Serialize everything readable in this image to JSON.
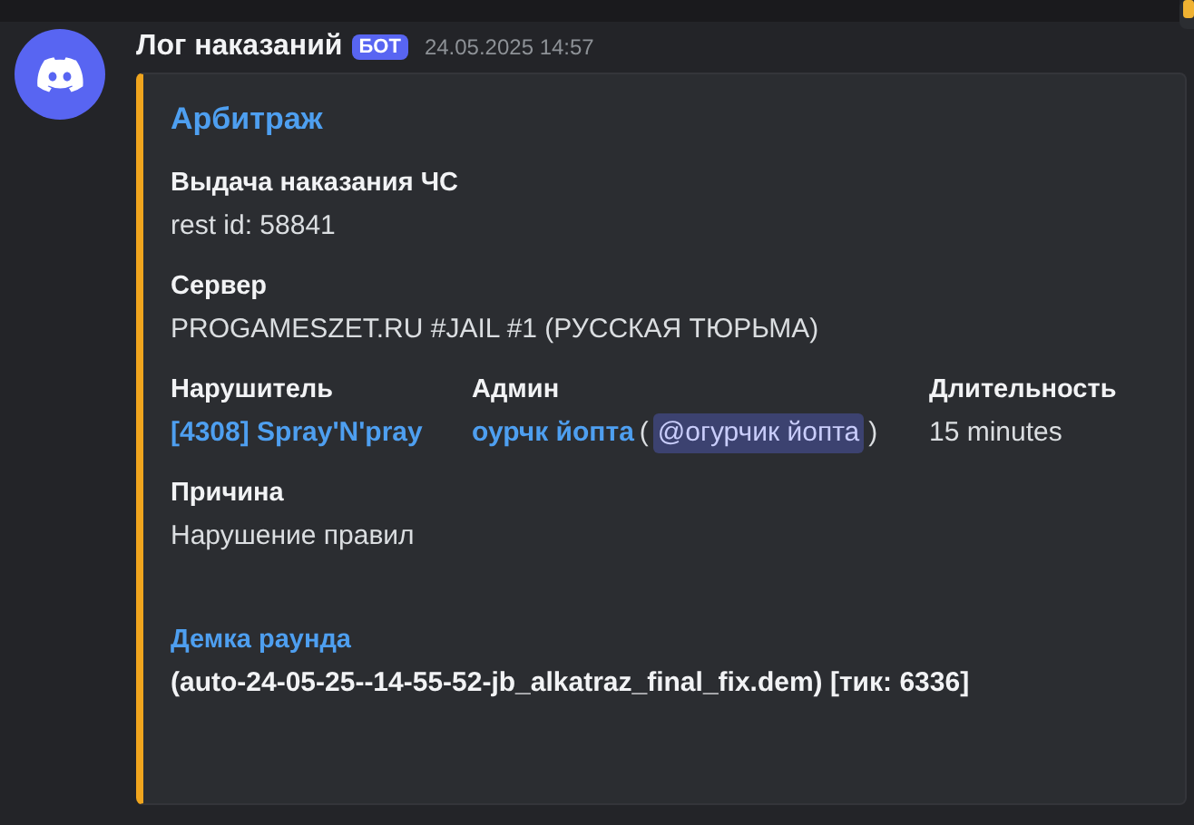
{
  "message": {
    "author": "Лог наказаний",
    "badge": "БОТ",
    "timestamp": "24.05.2025 14:57"
  },
  "embed": {
    "title": "Арбитраж",
    "rows": [
      [
        {
          "name": "Выдача наказания ЧС",
          "kind": "plain",
          "parts": [
            {
              "kind": "text",
              "text": "rest id: 58841"
            }
          ]
        }
      ],
      [
        {
          "name": "Сервер",
          "kind": "plain",
          "parts": [
            {
              "kind": "text",
              "text": "PROGAMESZET.RU #JAIL #1 (РУССКАЯ ТЮРЬМА)"
            }
          ]
        }
      ],
      [
        {
          "name": "Нарушитель",
          "kind": "plain",
          "parts": [
            {
              "kind": "link",
              "text": "[4308] Spray'N'pray"
            }
          ]
        },
        {
          "name": "Админ",
          "kind": "plain",
          "parts": [
            {
              "kind": "link",
              "text": "оурчк йопта"
            },
            {
              "kind": "text",
              "text": "("
            },
            {
              "kind": "mention",
              "text": "@огурчик йопта"
            },
            {
              "kind": "text",
              "text": ")"
            }
          ]
        },
        {
          "name": "Длительность",
          "kind": "plain",
          "parts": [
            {
              "kind": "text",
              "text": "15 minutes"
            }
          ]
        }
      ],
      [
        {
          "name": "Причина",
          "kind": "plain",
          "parts": [
            {
              "kind": "text",
              "text": "Нарушение правил"
            }
          ]
        }
      ],
      [
        {
          "name": "Демка раунда",
          "kind": "link",
          "parts": [
            {
              "kind": "bold",
              "text": "(auto-24-05-25--14-55-52-jb_alkatraz_final_fix.dem) [тик: 6336]"
            }
          ]
        }
      ]
    ]
  }
}
